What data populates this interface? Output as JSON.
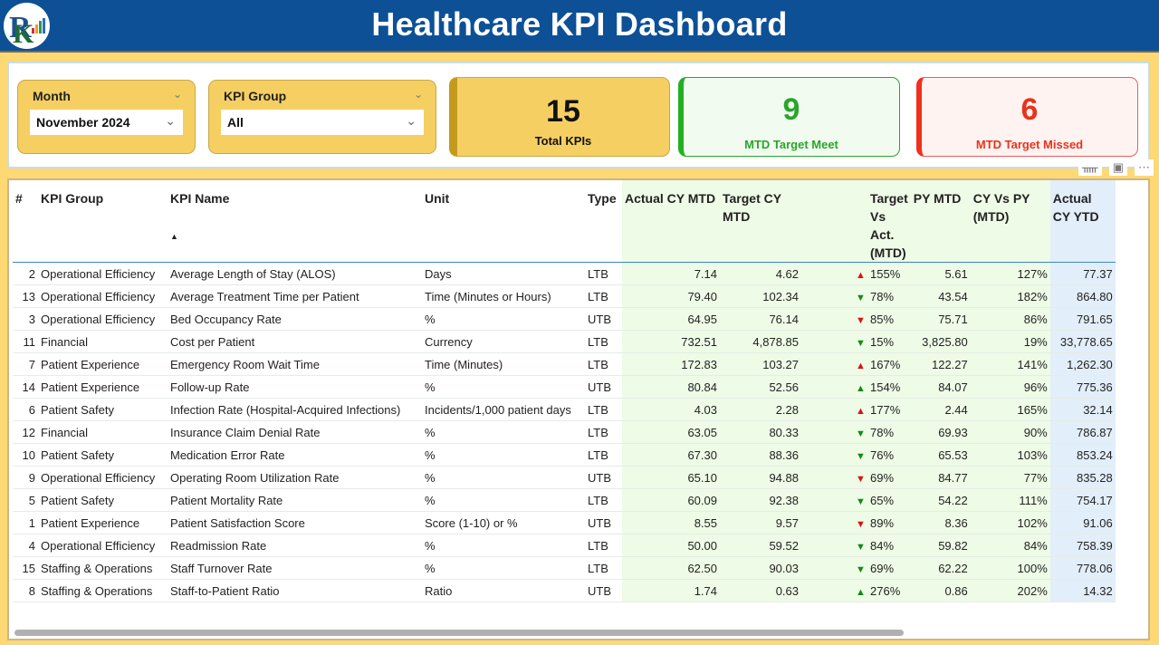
{
  "header": {
    "title": "Healthcare KPI Dashboard",
    "logo": "company-logo"
  },
  "filters": {
    "month": {
      "label": "Month",
      "value": "November 2024"
    },
    "kpi_group": {
      "label": "KPI Group",
      "value": "All"
    }
  },
  "cards": {
    "total": {
      "value": "15",
      "label": "Total KPIs",
      "color": "#c39a1a"
    },
    "meet": {
      "value": "9",
      "label": "MTD Target Meet",
      "color": "#2aa52a"
    },
    "missed": {
      "value": "6",
      "label": "MTD Target Missed",
      "color": "#e8321c"
    }
  },
  "visual_header_icons": [
    "filter-icon",
    "focus-mode-icon",
    "more-options-icon"
  ],
  "table": {
    "columns": [
      "#",
      "KPI Group",
      "KPI Name",
      "Unit",
      "Type",
      "Actual CY MTD",
      "Target CY MTD",
      "Target Vs Act. (MTD)",
      "PY MTD",
      "CY Vs PY (MTD)",
      "Actual CY YTD"
    ],
    "sort_indicator": "▲",
    "rows": [
      {
        "no": "2",
        "group": "Operational Efficiency",
        "name": "Average Length of Stay (ALOS)",
        "unit": "Days",
        "type": "LTB",
        "actual_mtd": "7.14",
        "target_mtd": "4.62",
        "indicator": "up-red",
        "tva": "155%",
        "py_mtd": "5.61",
        "cy_vs_py": "127%",
        "actual_ytd": "77.37"
      },
      {
        "no": "13",
        "group": "Operational Efficiency",
        "name": "Average Treatment Time per Patient",
        "unit": "Time (Minutes or Hours)",
        "type": "LTB",
        "actual_mtd": "79.40",
        "target_mtd": "102.34",
        "indicator": "down-green",
        "tva": "78%",
        "py_mtd": "43.54",
        "cy_vs_py": "182%",
        "actual_ytd": "864.80"
      },
      {
        "no": "3",
        "group": "Operational Efficiency",
        "name": "Bed Occupancy Rate",
        "unit": "%",
        "type": "UTB",
        "actual_mtd": "64.95",
        "target_mtd": "76.14",
        "indicator": "down-red",
        "tva": "85%",
        "py_mtd": "75.71",
        "cy_vs_py": "86%",
        "actual_ytd": "791.65"
      },
      {
        "no": "11",
        "group": "Financial",
        "name": "Cost per Patient",
        "unit": "Currency",
        "type": "LTB",
        "actual_mtd": "732.51",
        "target_mtd": "4,878.85",
        "indicator": "down-green",
        "tva": "15%",
        "py_mtd": "3,825.80",
        "cy_vs_py": "19%",
        "actual_ytd": "33,778.65"
      },
      {
        "no": "7",
        "group": "Patient Experience",
        "name": "Emergency Room Wait Time",
        "unit": "Time (Minutes)",
        "type": "LTB",
        "actual_mtd": "172.83",
        "target_mtd": "103.27",
        "indicator": "up-red",
        "tva": "167%",
        "py_mtd": "122.27",
        "cy_vs_py": "141%",
        "actual_ytd": "1,262.30"
      },
      {
        "no": "14",
        "group": "Patient Experience",
        "name": "Follow-up Rate",
        "unit": "%",
        "type": "UTB",
        "actual_mtd": "80.84",
        "target_mtd": "52.56",
        "indicator": "up-green",
        "tva": "154%",
        "py_mtd": "84.07",
        "cy_vs_py": "96%",
        "actual_ytd": "775.36"
      },
      {
        "no": "6",
        "group": "Patient Safety",
        "name": "Infection Rate (Hospital-Acquired Infections)",
        "unit": "Incidents/1,000 patient days",
        "type": "LTB",
        "actual_mtd": "4.03",
        "target_mtd": "2.28",
        "indicator": "up-red",
        "tva": "177%",
        "py_mtd": "2.44",
        "cy_vs_py": "165%",
        "actual_ytd": "32.14"
      },
      {
        "no": "12",
        "group": "Financial",
        "name": "Insurance Claim Denial Rate",
        "unit": "%",
        "type": "LTB",
        "actual_mtd": "63.05",
        "target_mtd": "80.33",
        "indicator": "down-green",
        "tva": "78%",
        "py_mtd": "69.93",
        "cy_vs_py": "90%",
        "actual_ytd": "786.87"
      },
      {
        "no": "10",
        "group": "Patient Safety",
        "name": "Medication Error Rate",
        "unit": "%",
        "type": "LTB",
        "actual_mtd": "67.30",
        "target_mtd": "88.36",
        "indicator": "down-green",
        "tva": "76%",
        "py_mtd": "65.53",
        "cy_vs_py": "103%",
        "actual_ytd": "853.24"
      },
      {
        "no": "9",
        "group": "Operational Efficiency",
        "name": "Operating Room Utilization Rate",
        "unit": "%",
        "type": "UTB",
        "actual_mtd": "65.10",
        "target_mtd": "94.88",
        "indicator": "down-red",
        "tva": "69%",
        "py_mtd": "84.77",
        "cy_vs_py": "77%",
        "actual_ytd": "835.28"
      },
      {
        "no": "5",
        "group": "Patient Safety",
        "name": "Patient Mortality Rate",
        "unit": "%",
        "type": "LTB",
        "actual_mtd": "60.09",
        "target_mtd": "92.38",
        "indicator": "down-green",
        "tva": "65%",
        "py_mtd": "54.22",
        "cy_vs_py": "111%",
        "actual_ytd": "754.17"
      },
      {
        "no": "1",
        "group": "Patient Experience",
        "name": "Patient Satisfaction Score",
        "unit": "Score (1-10) or %",
        "type": "UTB",
        "actual_mtd": "8.55",
        "target_mtd": "9.57",
        "indicator": "down-red",
        "tva": "89%",
        "py_mtd": "8.36",
        "cy_vs_py": "102%",
        "actual_ytd": "91.06"
      },
      {
        "no": "4",
        "group": "Operational Efficiency",
        "name": "Readmission Rate",
        "unit": "%",
        "type": "LTB",
        "actual_mtd": "50.00",
        "target_mtd": "59.52",
        "indicator": "down-green",
        "tva": "84%",
        "py_mtd": "59.82",
        "cy_vs_py": "84%",
        "actual_ytd": "758.39"
      },
      {
        "no": "15",
        "group": "Staffing & Operations",
        "name": "Staff Turnover Rate",
        "unit": "%",
        "type": "LTB",
        "actual_mtd": "62.50",
        "target_mtd": "90.03",
        "indicator": "down-green",
        "tva": "69%",
        "py_mtd": "62.22",
        "cy_vs_py": "100%",
        "actual_ytd": "778.06"
      },
      {
        "no": "8",
        "group": "Staffing & Operations",
        "name": "Staff-to-Patient Ratio",
        "unit": "Ratio",
        "type": "UTB",
        "actual_mtd": "1.74",
        "target_mtd": "0.63",
        "indicator": "up-green",
        "tva": "276%",
        "py_mtd": "0.86",
        "cy_vs_py": "202%",
        "actual_ytd": "14.32"
      }
    ]
  },
  "colors": {
    "header_bg": "#0d5096",
    "page_bg": "#fdd873",
    "mtd_col_bg": "#eefbe6",
    "ytd_col_bg": "#e2eef9",
    "up_red": "#e01010",
    "down_green": "#138a13"
  }
}
